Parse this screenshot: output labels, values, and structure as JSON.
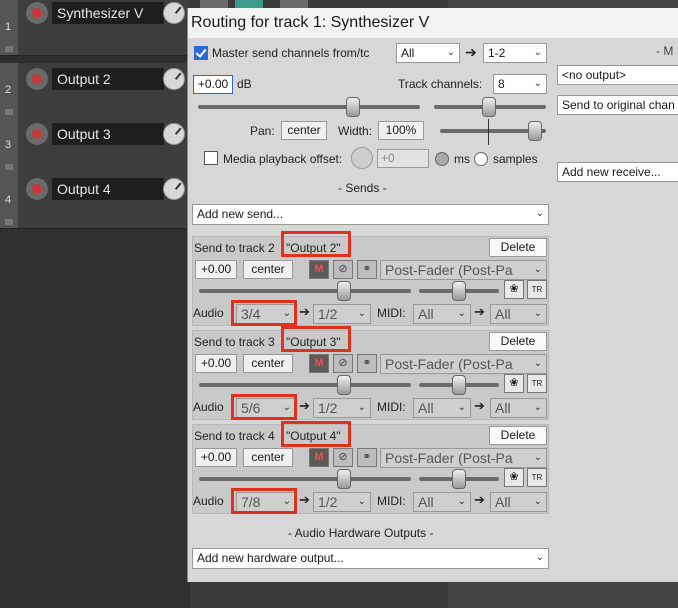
{
  "tracks": [
    {
      "number": "1",
      "name": "Synthesizer V"
    },
    {
      "number": "2",
      "name": "Output 2"
    },
    {
      "number": "3",
      "name": "Output 3"
    },
    {
      "number": "4",
      "name": "Output 4"
    }
  ],
  "dialog": {
    "title": "Routing for track 1: Synthesizer V",
    "master_send_label": "Master send channels from/tc",
    "master_send_checked": true,
    "master_from": "All",
    "master_to": "1-2",
    "volume_value": "+0.00",
    "volume_unit": "dB",
    "track_channels_label": "Track channels:",
    "track_channels_value": "8",
    "pan_label": "Pan:",
    "pan_value": "center",
    "width_label": "Width:",
    "width_value": "100%",
    "playback_offset_label": "Media playback offset:",
    "playback_offset_value": "+0",
    "ms_label": "ms",
    "samples_label": "samples",
    "sends_header": "- Sends -",
    "add_send_placeholder": "Add new send...",
    "hw_header": "- Audio Hardware Outputs -",
    "add_hw_placeholder": "Add new hardware output...",
    "right_header": "- M",
    "midi_output": "<no output>",
    "send_to_original": "Send to original chan",
    "add_receive": "Add new receive..."
  },
  "sends": [
    {
      "label": "Send to track 2",
      "target": "\"Output 2\"",
      "delete_label": "Delete",
      "volume": "+0.00",
      "pan": "center",
      "mode": "Post-Fader (Post-Pa",
      "audio_label": "Audio",
      "audio_src": "3/4",
      "audio_dst": "1/2",
      "midi_label": "MIDI:",
      "midi_src": "All",
      "midi_dst": "All",
      "mute_label": "M"
    },
    {
      "label": "Send to track 3",
      "target": "\"Output 3\"",
      "delete_label": "Delete",
      "volume": "+0.00",
      "pan": "center",
      "mode": "Post-Fader (Post-Pa",
      "audio_label": "Audio",
      "audio_src": "5/6",
      "audio_dst": "1/2",
      "midi_label": "MIDI:",
      "midi_src": "All",
      "midi_dst": "All",
      "mute_label": "M"
    },
    {
      "label": "Send to track 4",
      "target": "\"Output 4\"",
      "delete_label": "Delete",
      "volume": "+0.00",
      "pan": "center",
      "mode": "Post-Fader (Post-Pa",
      "audio_label": "Audio",
      "audio_src": "7/8",
      "audio_dst": "1/2",
      "midi_label": "MIDI:",
      "midi_src": "All",
      "midi_dst": "All",
      "mute_label": "M"
    }
  ],
  "colors": {
    "highlight": "#e0301e",
    "accent": "#2a6ad6"
  }
}
